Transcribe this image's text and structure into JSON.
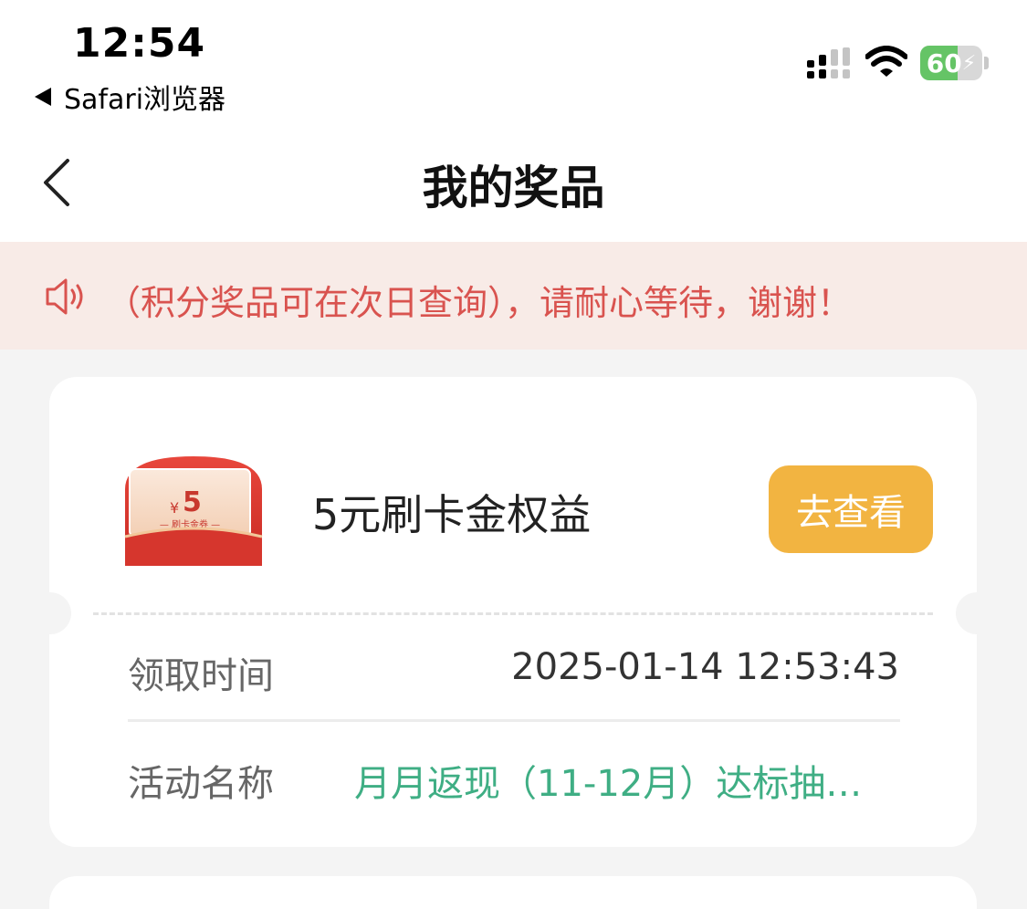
{
  "status_bar": {
    "time": "12:54",
    "back_app": "Safari浏览器",
    "battery_level": "60",
    "battery_fraction": 0.6
  },
  "nav": {
    "title": "我的奖品"
  },
  "notice": {
    "text": "（积分奖品可在次日查询），请耐心等待，谢谢！",
    "color": "#d9534f"
  },
  "prize": {
    "image_amount": "5",
    "image_currency": "¥",
    "image_caption": "— 刷卡金券 —",
    "name": "5元刷卡金权益",
    "action_label": "去查看",
    "action_color": "#f2b441",
    "details": [
      {
        "label": "领取时间",
        "value": "2025-01-14 12:53:43"
      },
      {
        "label": "活动名称",
        "value": "月月返现（11-12月）达标抽…"
      }
    ],
    "link_color": "#3fae84"
  }
}
